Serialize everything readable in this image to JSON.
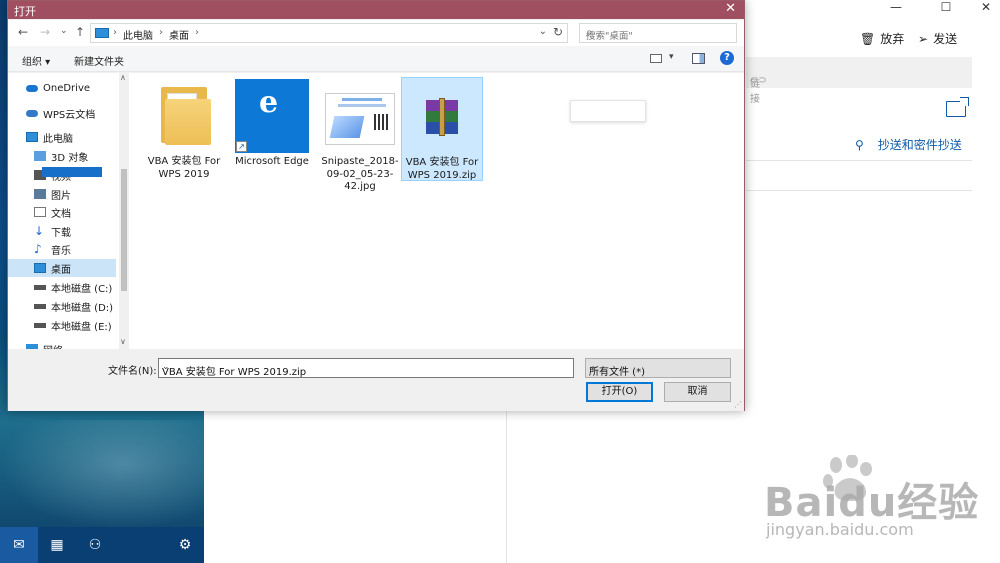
{
  "dialog": {
    "title": "打开",
    "close_glyph": "✕",
    "nav": {
      "back": "←",
      "forward": "→",
      "recent": "⌄",
      "up": "↑"
    },
    "breadcrumbs": [
      "此电脑",
      "桌面"
    ],
    "search_placeholder": "搜索\"桌面\"",
    "toolbar": {
      "organize": "组织 ▾",
      "new_folder": "新建文件夹"
    },
    "sidebar": [
      {
        "label": "OneDrive",
        "icon": "cloud-icon",
        "color": "#1b74d0"
      },
      {
        "label": "WPS云文档",
        "icon": "cloud-icon",
        "color": "#3478c8"
      },
      {
        "label": "此电脑",
        "icon": "computer-icon",
        "color": "#2d8fd8"
      },
      {
        "label": "3D 对象",
        "icon": "cube-icon",
        "color": "#5aa0e0"
      },
      {
        "label": "视频",
        "icon": "video-icon",
        "color": "#555"
      },
      {
        "label": "图片",
        "icon": "picture-icon",
        "color": "#5a7a9a"
      },
      {
        "label": "文档",
        "icon": "document-icon",
        "color": "#777"
      },
      {
        "label": "下载",
        "icon": "download-icon",
        "color": "#1c6ad6"
      },
      {
        "label": "音乐",
        "icon": "music-icon",
        "color": "#1c6ad6"
      },
      {
        "label": "桌面",
        "icon": "desktop-icon",
        "color": "#2d8fd8",
        "selected": true
      },
      {
        "label": "本地磁盘 (C:)",
        "icon": "drive-icon",
        "color": "#555"
      },
      {
        "label": "本地磁盘 (D:)",
        "icon": "drive-icon",
        "color": "#555"
      },
      {
        "label": "本地磁盘 (E:)",
        "icon": "drive-icon",
        "color": "#555"
      },
      {
        "label": "网络",
        "icon": "network-icon",
        "color": "#2d8fd8"
      }
    ],
    "files": [
      {
        "label": "VBA 安装包 For WPS 2019",
        "type": "folder"
      },
      {
        "label": "Microsoft Edge",
        "type": "shortcut"
      },
      {
        "label": "Snipaste_2018-09-02_05-23-42.jpg",
        "type": "image"
      },
      {
        "label": "VBA 安装包 For WPS 2019.zip",
        "type": "archive",
        "selected": true
      }
    ],
    "filename_label": "文件名(N):",
    "filename_value": "VBA 安装包 For WPS 2019.zip",
    "filetype_value": "所有文件 (*)",
    "open_button": "打开(O)",
    "cancel_button": "取消"
  },
  "background": {
    "window_controls": [
      "—",
      "☐",
      "✕"
    ],
    "discard": "放弃",
    "send": "发送",
    "link": "链接",
    "cc_bcc": "抄送和密件抄送"
  },
  "watermark": {
    "brand": "Baidu经验",
    "url": "jingyan.baidu.com"
  },
  "colors": {
    "titlebar": "#9f4f5f",
    "selection": "#cce4f7",
    "accent": "#0078d7"
  }
}
